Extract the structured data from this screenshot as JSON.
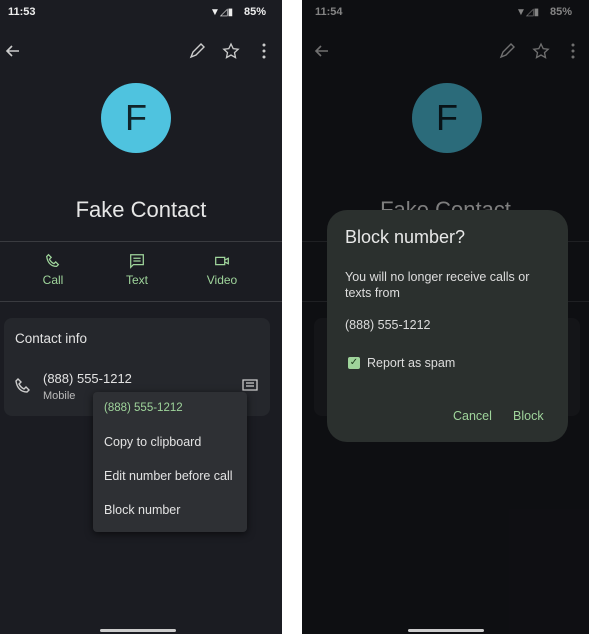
{
  "left": {
    "status": {
      "time": "11:53",
      "battery": "85%"
    },
    "avatar_letter": "F",
    "contact_name": "Fake Contact",
    "actions": [
      {
        "label": "Call",
        "icon": "phone-icon"
      },
      {
        "label": "Text",
        "icon": "message-icon"
      },
      {
        "label": "Video",
        "icon": "video-icon"
      }
    ],
    "contact_info": {
      "title": "Contact info",
      "phone": "(888) 555-1212",
      "type": "Mobile"
    },
    "menu": {
      "header": "(888) 555-1212",
      "items": [
        "Copy to clipboard",
        "Edit number before call",
        "Block number"
      ]
    }
  },
  "right": {
    "status": {
      "time": "11:54",
      "battery": "85%"
    },
    "avatar_letter": "F",
    "contact_name": "Fake Contact",
    "dialog": {
      "title": "Block number?",
      "body": "You will no longer receive calls or texts from",
      "number": "(888) 555-1212",
      "checkbox_label": "Report as spam",
      "checkbox_checked": true,
      "cancel": "Cancel",
      "confirm": "Block"
    }
  },
  "colors": {
    "accent": "#9fd49b",
    "avatar": "#4fc3df",
    "background": "#1b1c22"
  }
}
